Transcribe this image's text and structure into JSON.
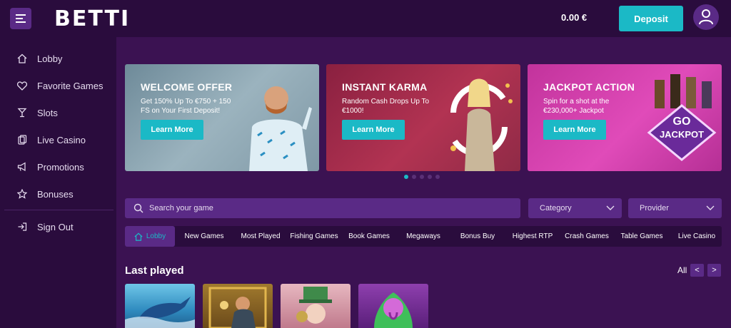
{
  "header": {
    "logo": "BETTI",
    "balance": "0.00 €",
    "deposit_label": "Deposit"
  },
  "sidebar": {
    "items": [
      {
        "label": "Lobby",
        "icon": "home-icon"
      },
      {
        "label": "Favorite Games",
        "icon": "heart-icon"
      },
      {
        "label": "Slots",
        "icon": "cocktail-icon"
      },
      {
        "label": "Live Casino",
        "icon": "cards-icon"
      },
      {
        "label": "Promotions",
        "icon": "megaphone-icon"
      },
      {
        "label": "Bonuses",
        "icon": "star-icon"
      }
    ],
    "sign_out": {
      "label": "Sign Out",
      "icon": "sign-out-icon"
    }
  },
  "banners": [
    {
      "title": "WELCOME OFFER",
      "text": "Get 150% Up To €750 + 150 FS on Your First Deposit!",
      "button": "Learn More"
    },
    {
      "title": "INSTANT KARMA",
      "text": "Random Cash Drops Up To €1000!",
      "button": "Learn More"
    },
    {
      "title": "JACKPOT ACTION",
      "text": "Spin for a shot at the €230,000+ Jackpot",
      "button": "Learn More",
      "badge_top": "GO",
      "badge_main": "JACKPOT"
    }
  ],
  "carousel": {
    "count": 5,
    "active": 0
  },
  "search": {
    "placeholder": "Search your game"
  },
  "filters": {
    "category": "Category",
    "provider": "Provider"
  },
  "tabs": [
    "Lobby",
    "New Games",
    "Most Played",
    "Fishing Games",
    "Book Games",
    "Megaways",
    "Bonus Buy",
    "Highest RTP",
    "Crash Games",
    "Table Games",
    "Live Casino"
  ],
  "active_tab": "Lobby",
  "last_played": {
    "title": "Last played",
    "all_label": "All",
    "prev": "<",
    "next": ">"
  },
  "colors": {
    "accent": "#1bb9c6",
    "background": "#3b1252",
    "panel": "#2a0c3d",
    "control": "#5a2a86"
  }
}
